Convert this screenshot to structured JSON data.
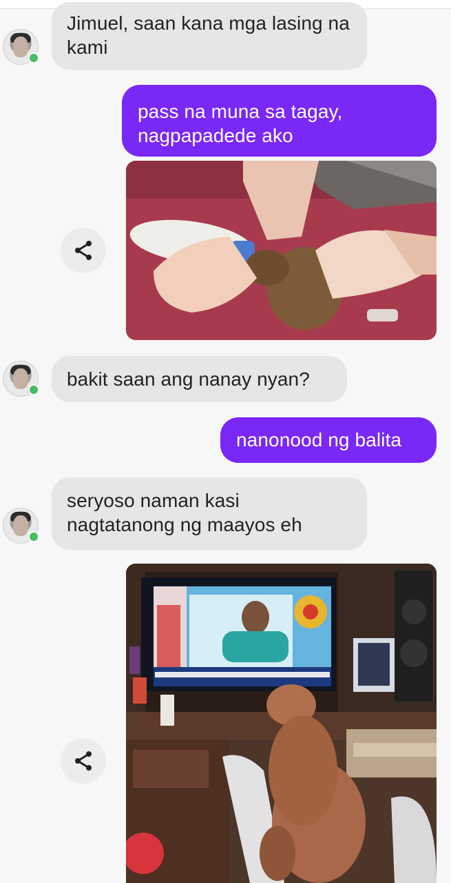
{
  "messages": {
    "m1": "Jimuel, saan kana mga lasing na kami",
    "m2": "pass na muna sa tagay, nagpapadede ako",
    "m3": "bakit saan ang nanay nyan?",
    "m4": "nanonood ng balita",
    "m5": "seryoso naman kasi nagtatanong ng maayos eh"
  },
  "icons": {
    "share": "share-icon",
    "presence": "online-dot-icon"
  },
  "colors": {
    "outgoing_bubble": "#7a28f5",
    "incoming_bubble": "#e6e6e8",
    "online": "#45bd62"
  }
}
